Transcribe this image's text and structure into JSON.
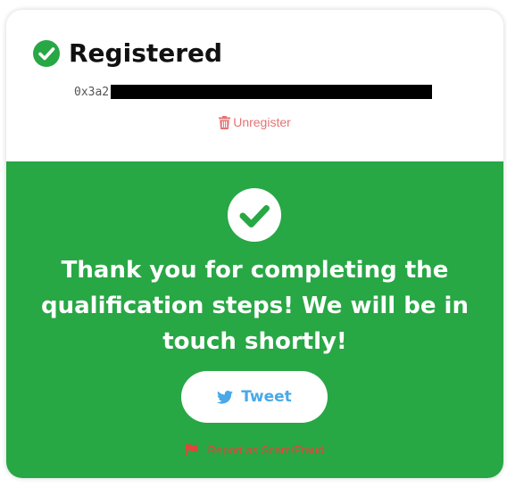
{
  "status": {
    "title": "Registered",
    "icon": "check-circle-icon",
    "icon_color": "#28a745"
  },
  "address": {
    "prefix": "0x3a2"
  },
  "unregister": {
    "label": "Unregister",
    "icon": "trash-icon",
    "color": "#e57373"
  },
  "success": {
    "background": "#28a745",
    "icon": "check-circle-icon",
    "message": "Thank you for completing the qualification steps! We will be in touch shortly!"
  },
  "tweet_button": {
    "label": "Tweet",
    "icon": "twitter-icon",
    "color": "#4aa8e8"
  },
  "report": {
    "label": "Report as Scam/Fraud",
    "icon": "flag-icon",
    "color": "#e0463a"
  }
}
